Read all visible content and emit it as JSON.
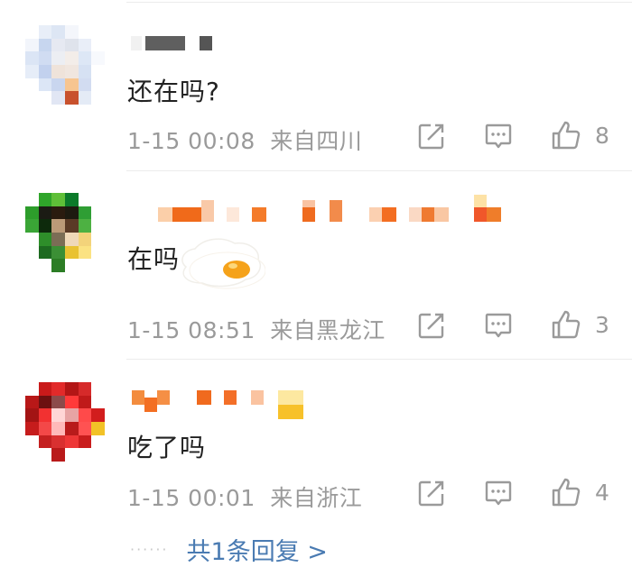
{
  "comments": [
    {
      "text": "还在吗?",
      "time": "1-15 00:08",
      "location": "来自四川",
      "likes": "8"
    },
    {
      "text": "在吗",
      "time": "1-15 08:51",
      "location": "来自黑龙江",
      "likes": "3"
    },
    {
      "text": "吃了吗",
      "time": "1-15 00:01",
      "location": "来自浙江",
      "likes": "4"
    }
  ],
  "replies_link": "共1条回复 >",
  "icons": {
    "share": "share-icon",
    "comment": "comment-icon",
    "like": "thumbs-up-icon",
    "sticker": "fried-egg-sticker"
  },
  "colors": {
    "text": "#222222",
    "meta": "#9a9a9a",
    "link": "#4a7bb2",
    "divider": "#ececec",
    "icon": "#9a9a9a"
  }
}
